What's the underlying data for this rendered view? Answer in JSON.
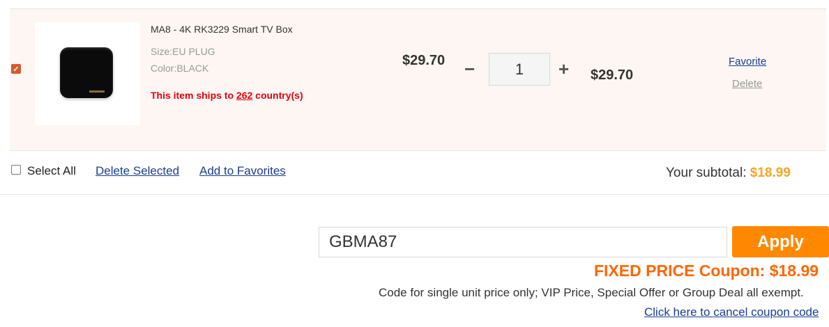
{
  "cart": {
    "item": {
      "checked": true,
      "check_glyph": "✓",
      "title": "MA8 - 4K RK3229 Smart TV Box",
      "size": "Size:EU PLUG",
      "color": "Color:BLACK",
      "ships_prefix": "This item ships to ",
      "ships_count": "262",
      "ships_suffix": " country(s)",
      "unit_price": "$29.70",
      "quantity": "1",
      "minus_glyph": "−",
      "plus_glyph": "+",
      "row_total": "$29.70",
      "favorite_label": "Favorite",
      "delete_label": "Delete",
      "image_icon": "tv-box-product-image"
    },
    "footer": {
      "select_all_label": "Select All",
      "delete_selected_label": "Delete Selected",
      "add_to_favorites_label": "Add to Favorites",
      "subtotal_label": "Your subtotal: ",
      "subtotal_value": "$18.99"
    }
  },
  "coupon": {
    "code_value": "GBMA87",
    "apply_label": "Apply",
    "message": "FIXED PRICE Coupon: $18.99",
    "note": "Code for single unit price only; VIP Price, Special Offer or Group Deal all exempt.",
    "cancel_link": "Click here to cancel coupon code"
  },
  "colors": {
    "accent_orange": "#ff8800",
    "coupon_text": "#ff6600",
    "subtotal_value": "#f5a623",
    "ships_red": "#e3000e",
    "link_blue": "#1a3d8f",
    "row_background": "#fdf6f2"
  }
}
